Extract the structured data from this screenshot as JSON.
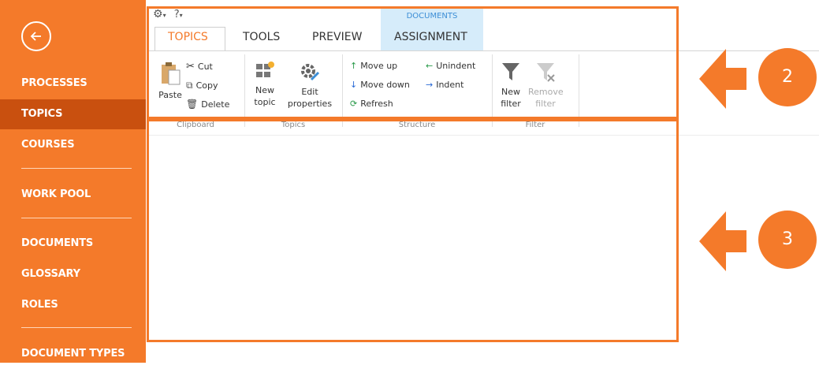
{
  "sidebar": {
    "items": [
      {
        "label": "PROCESSES"
      },
      {
        "label": "TOPICS"
      },
      {
        "label": "COURSES"
      },
      {
        "label": "WORK POOL"
      },
      {
        "label": "DOCUMENTS"
      },
      {
        "label": "GLOSSARY"
      },
      {
        "label": "ROLES"
      },
      {
        "label": "DOCUMENT TYPES"
      }
    ],
    "active": "TOPICS"
  },
  "quick_access": {
    "help": "?"
  },
  "tabs": {
    "context_title": "DOCUMENTS",
    "items": [
      {
        "label": "TOPICS"
      },
      {
        "label": "TOOLS"
      },
      {
        "label": "PREVIEW"
      },
      {
        "label": "ASSIGNMENT"
      }
    ]
  },
  "ribbon": {
    "clipboard": {
      "paste": "Paste",
      "cut": "Cut",
      "copy": "Copy",
      "delete": "Delete",
      "group_label": "Clipboard"
    },
    "topics": {
      "new_topic_1": "New",
      "new_topic_2": "topic",
      "edit_1": "Edit",
      "edit_2": "properties",
      "group_label": "Topics"
    },
    "structure": {
      "move_up": "Move up",
      "move_down": "Move down",
      "unindent": "Unindent",
      "indent": "Indent",
      "refresh": "Refresh",
      "group_label": "Structure"
    },
    "filter": {
      "new_1": "New",
      "new_2": "filter",
      "remove_1": "Remove",
      "remove_2": "filter",
      "group_label": "Filter"
    }
  },
  "callouts": {
    "ribbon_number": "2",
    "content_number": "3"
  },
  "colors": {
    "accent": "#f47a2a",
    "active_nav": "#c9500f",
    "context_tab": "#d6ecfa",
    "context_text": "#3c8ed6"
  }
}
